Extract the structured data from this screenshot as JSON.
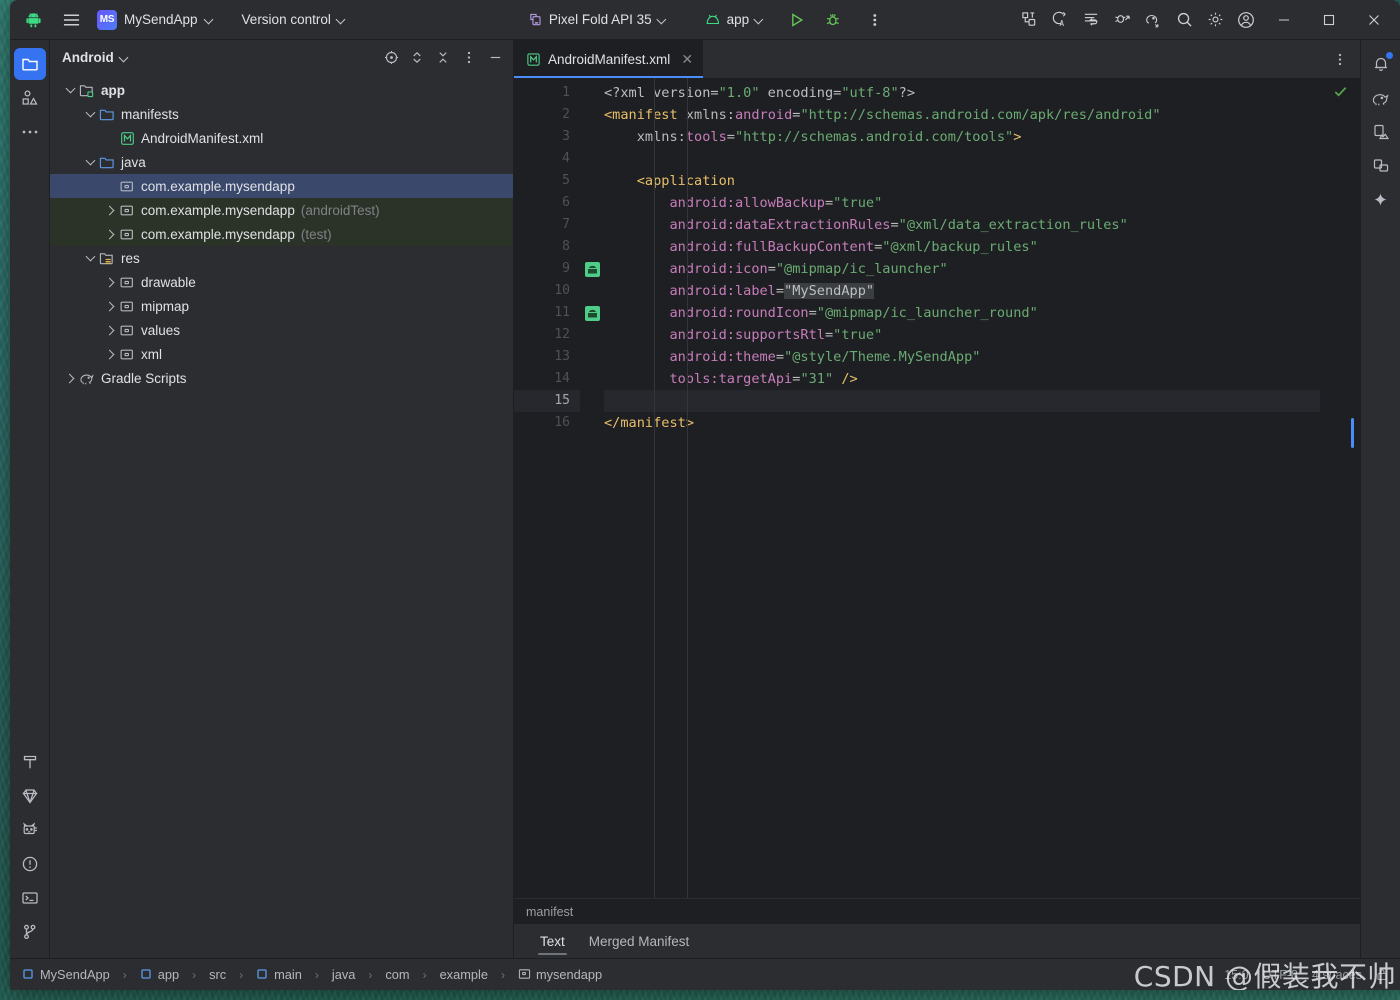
{
  "titlebar": {
    "app_icon": "android-logo-icon",
    "menu_icon": "hamburger-menu-icon",
    "project_badge": "MS",
    "project_name": "MySendApp",
    "version_control": "Version control",
    "device": "Pixel Fold API 35",
    "run_config": "app",
    "run_icon": "run-play-icon",
    "debug_icon": "debug-bug-icon",
    "more_icon": "more-vertical-icon",
    "right_icons": [
      {
        "name": "code-with-me-icon"
      },
      {
        "name": "search-everywhere-code-icon"
      },
      {
        "name": "terminal-output-icon"
      },
      {
        "name": "profiler-icon"
      },
      {
        "name": "gradle-sync-icon"
      },
      {
        "name": "search-icon"
      },
      {
        "name": "settings-gear-icon"
      },
      {
        "name": "account-avatar-icon"
      }
    ],
    "window_minimize": "—",
    "window_maximize": "□",
    "window_close": "✕"
  },
  "left_rail": {
    "top": [
      {
        "name": "project-folder-icon",
        "active": true
      },
      {
        "name": "resource-manager-icon",
        "active": false
      },
      {
        "name": "more-tool-windows-icon",
        "active": false
      }
    ],
    "bottom": [
      {
        "name": "build-hammer-icon"
      },
      {
        "name": "gradle-diamond-icon"
      },
      {
        "name": "logcat-cat-icon"
      },
      {
        "name": "problems-warning-icon"
      },
      {
        "name": "terminal-icon"
      },
      {
        "name": "version-control-branch-icon"
      }
    ]
  },
  "right_rail": [
    {
      "name": "notifications-bell-icon",
      "badge": true
    },
    {
      "name": "gradle-elephant-icon",
      "badge": false
    },
    {
      "name": "device-manager-icon",
      "badge": false
    },
    {
      "name": "running-devices-icon",
      "badge": false
    },
    {
      "name": "gemini-sparkle-icon",
      "badge": false
    }
  ],
  "project_panel": {
    "title": "Android",
    "header_icons": [
      {
        "name": "select-opened-file-icon"
      },
      {
        "name": "expand-collapse-icon"
      },
      {
        "name": "collapse-all-icon"
      },
      {
        "name": "panel-options-icon"
      },
      {
        "name": "hide-panel-icon"
      }
    ],
    "tree": [
      {
        "depth": 0,
        "twisty": "open",
        "icon": "module-app-icon",
        "label": "app",
        "sub": "",
        "bold": true,
        "state": "normal"
      },
      {
        "depth": 1,
        "twisty": "open",
        "icon": "folder-blue-icon",
        "label": "manifests",
        "sub": "",
        "bold": false,
        "state": "normal"
      },
      {
        "depth": 2,
        "twisty": "none",
        "icon": "manifest-file-icon",
        "label": "AndroidManifest.xml",
        "sub": "",
        "bold": false,
        "state": "normal"
      },
      {
        "depth": 1,
        "twisty": "open",
        "icon": "folder-blue-icon",
        "label": "java",
        "sub": "",
        "bold": false,
        "state": "normal"
      },
      {
        "depth": 2,
        "twisty": "none",
        "icon": "package-icon",
        "label": "com.example.mysendapp",
        "sub": "",
        "bold": false,
        "state": "selected"
      },
      {
        "depth": 2,
        "twisty": "closed",
        "icon": "package-icon",
        "label": "com.example.mysendapp",
        "sub": "(androidTest)",
        "bold": false,
        "state": "test"
      },
      {
        "depth": 2,
        "twisty": "closed",
        "icon": "package-icon",
        "label": "com.example.mysendapp",
        "sub": "(test)",
        "bold": false,
        "state": "test"
      },
      {
        "depth": 1,
        "twisty": "open",
        "icon": "res-folder-icon",
        "label": "res",
        "sub": "",
        "bold": false,
        "state": "normal"
      },
      {
        "depth": 2,
        "twisty": "closed",
        "icon": "package-icon",
        "label": "drawable",
        "sub": "",
        "bold": false,
        "state": "normal"
      },
      {
        "depth": 2,
        "twisty": "closed",
        "icon": "package-icon",
        "label": "mipmap",
        "sub": "",
        "bold": false,
        "state": "normal"
      },
      {
        "depth": 2,
        "twisty": "closed",
        "icon": "package-icon",
        "label": "values",
        "sub": "",
        "bold": false,
        "state": "normal"
      },
      {
        "depth": 2,
        "twisty": "closed",
        "icon": "package-icon",
        "label": "xml",
        "sub": "",
        "bold": false,
        "state": "normal"
      },
      {
        "depth": 0,
        "twisty": "closed",
        "icon": "gradle-elephant-icon",
        "label": "Gradle Scripts",
        "sub": "",
        "bold": false,
        "state": "normal"
      }
    ]
  },
  "editor": {
    "tab_label": "AndroidManifest.xml",
    "tab_icon": "manifest-file-icon",
    "tab_close": "✕",
    "tab_options_icon": "more-vertical-icon",
    "inspection_status_icon": "check-ok-icon",
    "caret_line": 15,
    "total_lines": 16,
    "breadcrumb": "manifest",
    "bottom_tabs": [
      {
        "label": "Text",
        "active": true
      },
      {
        "label": "Merged Manifest",
        "active": false
      }
    ],
    "lines": [
      {
        "n": 1,
        "mark": "",
        "tokens": [
          {
            "t": "punct",
            "s": "<?xml version="
          },
          {
            "t": "val",
            "s": "\"1.0\""
          },
          {
            "t": "punct",
            "s": " encoding="
          },
          {
            "t": "val",
            "s": "\"utf-8\""
          },
          {
            "t": "punct",
            "s": "?>"
          }
        ]
      },
      {
        "n": 2,
        "mark": "",
        "tokens": [
          {
            "t": "tag",
            "s": "<manifest"
          },
          {
            "t": "attr",
            "s": " xmlns:"
          },
          {
            "t": "ns",
            "s": "android"
          },
          {
            "t": "attr",
            "s": "="
          },
          {
            "t": "val",
            "s": "\"http://schemas.android.com/apk/res/android\""
          }
        ]
      },
      {
        "n": 3,
        "mark": "",
        "tokens": [
          {
            "t": "attr",
            "s": "    xmlns:"
          },
          {
            "t": "ns",
            "s": "tools"
          },
          {
            "t": "attr",
            "s": "="
          },
          {
            "t": "val",
            "s": "\"http://schemas.android.com/tools\""
          },
          {
            "t": "tag",
            "s": ">"
          }
        ]
      },
      {
        "n": 4,
        "mark": "",
        "tokens": []
      },
      {
        "n": 5,
        "mark": "",
        "tokens": [
          {
            "t": "tag",
            "s": "    <application"
          }
        ]
      },
      {
        "n": 6,
        "mark": "",
        "tokens": [
          {
            "t": "ns",
            "s": "        android:allowBackup"
          },
          {
            "t": "attr",
            "s": "="
          },
          {
            "t": "val",
            "s": "\"true\""
          }
        ]
      },
      {
        "n": 7,
        "mark": "",
        "tokens": [
          {
            "t": "ns",
            "s": "        android:dataExtractionRules"
          },
          {
            "t": "attr",
            "s": "="
          },
          {
            "t": "val",
            "s": "\"@xml/data_extraction_rules\""
          }
        ]
      },
      {
        "n": 8,
        "mark": "",
        "tokens": [
          {
            "t": "ns",
            "s": "        android:fullBackupContent"
          },
          {
            "t": "attr",
            "s": "="
          },
          {
            "t": "val",
            "s": "\"@xml/backup_rules\""
          }
        ]
      },
      {
        "n": 9,
        "mark": "android",
        "tokens": [
          {
            "t": "ns",
            "s": "        android:icon"
          },
          {
            "t": "attr",
            "s": "="
          },
          {
            "t": "val",
            "s": "\"@mipmap/ic_launcher\""
          }
        ]
      },
      {
        "n": 10,
        "mark": "",
        "tokens": [
          {
            "t": "ns",
            "s": "        android:label"
          },
          {
            "t": "attr",
            "s": "="
          },
          {
            "t": "sel",
            "s": "\"MySendApp\""
          }
        ]
      },
      {
        "n": 11,
        "mark": "android",
        "tokens": [
          {
            "t": "ns",
            "s": "        android:roundIcon"
          },
          {
            "t": "attr",
            "s": "="
          },
          {
            "t": "val",
            "s": "\"@mipmap/ic_launcher_round\""
          }
        ]
      },
      {
        "n": 12,
        "mark": "",
        "tokens": [
          {
            "t": "ns",
            "s": "        android:supportsRtl"
          },
          {
            "t": "attr",
            "s": "="
          },
          {
            "t": "val",
            "s": "\"true\""
          }
        ]
      },
      {
        "n": 13,
        "mark": "",
        "tokens": [
          {
            "t": "ns",
            "s": "        android:theme"
          },
          {
            "t": "attr",
            "s": "="
          },
          {
            "t": "val",
            "s": "\"@style/Theme.MySendApp\""
          }
        ]
      },
      {
        "n": 14,
        "mark": "",
        "tokens": [
          {
            "t": "ns",
            "s": "        tools:targetApi"
          },
          {
            "t": "attr",
            "s": "="
          },
          {
            "t": "val",
            "s": "\"31\""
          },
          {
            "t": "attr",
            "s": " "
          },
          {
            "t": "tag",
            "s": "/>"
          }
        ]
      },
      {
        "n": 15,
        "mark": "",
        "tokens": []
      },
      {
        "n": 16,
        "mark": "",
        "tokens": [
          {
            "t": "tag",
            "s": "</manifest>"
          }
        ]
      }
    ]
  },
  "statusbar": {
    "crumbs": [
      {
        "label": "MySendApp",
        "icon": "module-square-icon"
      },
      {
        "label": "app",
        "icon": "module-square-icon"
      },
      {
        "label": "src",
        "icon": ""
      },
      {
        "label": "main",
        "icon": "module-square-icon"
      },
      {
        "label": "java",
        "icon": ""
      },
      {
        "label": "com",
        "icon": ""
      },
      {
        "label": "example",
        "icon": ""
      },
      {
        "label": "mysendapp",
        "icon": "package-icon"
      }
    ],
    "separator": "›",
    "time": "15:0",
    "encoding": "UTF-8",
    "spaces": "4 spaces",
    "watermark": "CSDN @假装我不帅"
  },
  "colors": {
    "accent_blue": "#3574f0",
    "android_green": "#3ddc84",
    "selection_blue": "#39486b",
    "test_green_bg": "#2b3328",
    "editor_bg": "#1e1f22",
    "chrome_bg": "#2b2d30",
    "xml_tag": "#e8bf6a",
    "xml_value": "#6aab73",
    "xml_ns": "#c77dbb"
  }
}
